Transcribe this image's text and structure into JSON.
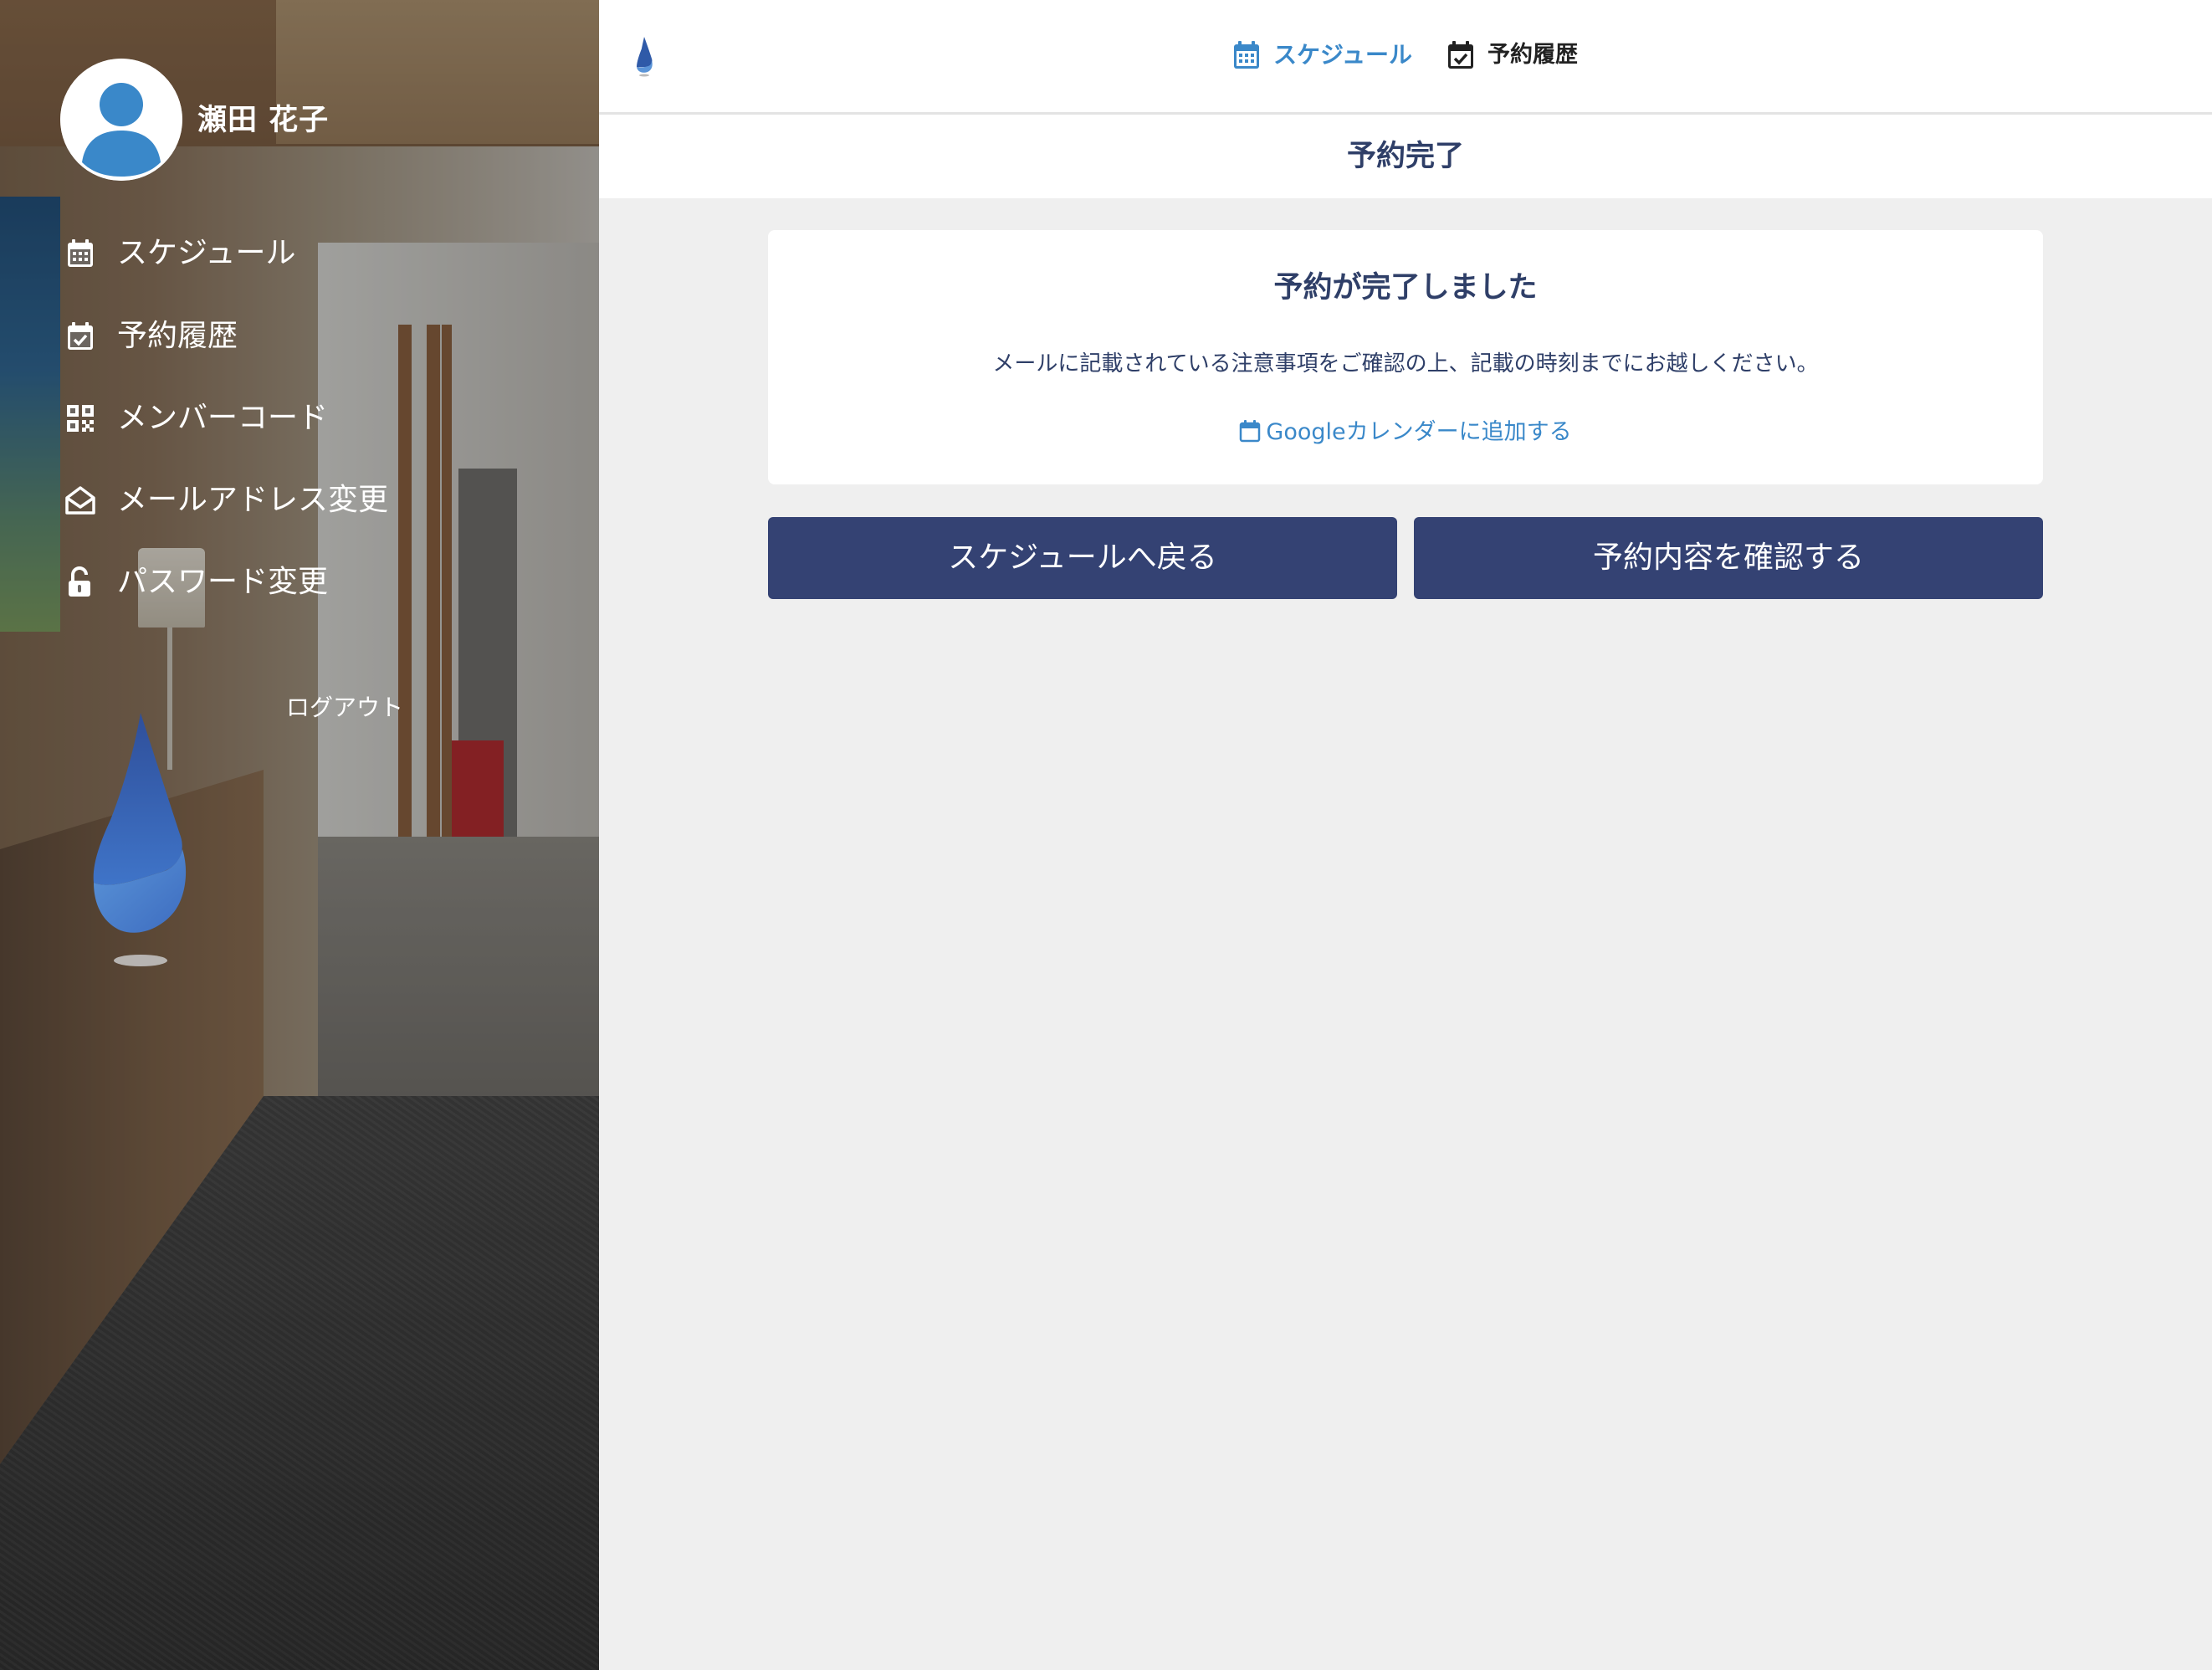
{
  "user": {
    "name": "瀬田 花子"
  },
  "sidebar": {
    "items": [
      {
        "label": "スケジュール",
        "icon": "calendar-icon"
      },
      {
        "label": "予約履歴",
        "icon": "calendar-check-icon"
      },
      {
        "label": "メンバーコード",
        "icon": "qr-code-icon"
      },
      {
        "label": "メールアドレス変更",
        "icon": "envelope-open-icon"
      },
      {
        "label": "パスワード変更",
        "icon": "unlock-icon"
      }
    ],
    "logout_label": "ログアウト"
  },
  "header": {
    "tabs": [
      {
        "label": "スケジュール",
        "icon": "calendar-icon",
        "active": true
      },
      {
        "label": "予約履歴",
        "icon": "calendar-check-icon",
        "active": false
      }
    ],
    "page_title": "予約完了"
  },
  "card": {
    "title": "予約が完了しました",
    "message": "メールに記載されている注意事項をご確認の上、記載の時刻までにお越しください。",
    "calendar_link": "Googleカレンダーに追加する"
  },
  "buttons": {
    "back": "スケジュールへ戻る",
    "confirm": "予約内容を確認する"
  },
  "colors": {
    "accent": "#3a88c9",
    "primary_button": "#344273",
    "heading_text": "#2f3f68",
    "content_background": "#efefef"
  }
}
